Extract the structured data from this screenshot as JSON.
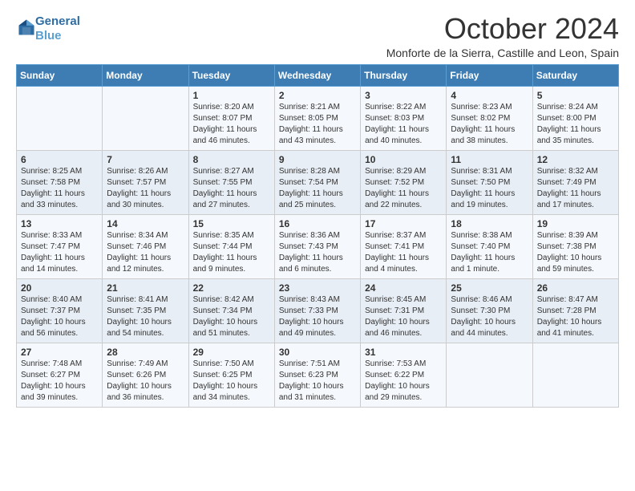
{
  "header": {
    "logo_line1": "General",
    "logo_line2": "Blue",
    "month_title": "October 2024",
    "location": "Monforte de la Sierra, Castille and Leon, Spain"
  },
  "weekdays": [
    "Sunday",
    "Monday",
    "Tuesday",
    "Wednesday",
    "Thursday",
    "Friday",
    "Saturday"
  ],
  "weeks": [
    [
      {
        "day": "",
        "info": ""
      },
      {
        "day": "",
        "info": ""
      },
      {
        "day": "1",
        "info": "Sunrise: 8:20 AM\nSunset: 8:07 PM\nDaylight: 11 hours and 46 minutes."
      },
      {
        "day": "2",
        "info": "Sunrise: 8:21 AM\nSunset: 8:05 PM\nDaylight: 11 hours and 43 minutes."
      },
      {
        "day": "3",
        "info": "Sunrise: 8:22 AM\nSunset: 8:03 PM\nDaylight: 11 hours and 40 minutes."
      },
      {
        "day": "4",
        "info": "Sunrise: 8:23 AM\nSunset: 8:02 PM\nDaylight: 11 hours and 38 minutes."
      },
      {
        "day": "5",
        "info": "Sunrise: 8:24 AM\nSunset: 8:00 PM\nDaylight: 11 hours and 35 minutes."
      }
    ],
    [
      {
        "day": "6",
        "info": "Sunrise: 8:25 AM\nSunset: 7:58 PM\nDaylight: 11 hours and 33 minutes."
      },
      {
        "day": "7",
        "info": "Sunrise: 8:26 AM\nSunset: 7:57 PM\nDaylight: 11 hours and 30 minutes."
      },
      {
        "day": "8",
        "info": "Sunrise: 8:27 AM\nSunset: 7:55 PM\nDaylight: 11 hours and 27 minutes."
      },
      {
        "day": "9",
        "info": "Sunrise: 8:28 AM\nSunset: 7:54 PM\nDaylight: 11 hours and 25 minutes."
      },
      {
        "day": "10",
        "info": "Sunrise: 8:29 AM\nSunset: 7:52 PM\nDaylight: 11 hours and 22 minutes."
      },
      {
        "day": "11",
        "info": "Sunrise: 8:31 AM\nSunset: 7:50 PM\nDaylight: 11 hours and 19 minutes."
      },
      {
        "day": "12",
        "info": "Sunrise: 8:32 AM\nSunset: 7:49 PM\nDaylight: 11 hours and 17 minutes."
      }
    ],
    [
      {
        "day": "13",
        "info": "Sunrise: 8:33 AM\nSunset: 7:47 PM\nDaylight: 11 hours and 14 minutes."
      },
      {
        "day": "14",
        "info": "Sunrise: 8:34 AM\nSunset: 7:46 PM\nDaylight: 11 hours and 12 minutes."
      },
      {
        "day": "15",
        "info": "Sunrise: 8:35 AM\nSunset: 7:44 PM\nDaylight: 11 hours and 9 minutes."
      },
      {
        "day": "16",
        "info": "Sunrise: 8:36 AM\nSunset: 7:43 PM\nDaylight: 11 hours and 6 minutes."
      },
      {
        "day": "17",
        "info": "Sunrise: 8:37 AM\nSunset: 7:41 PM\nDaylight: 11 hours and 4 minutes."
      },
      {
        "day": "18",
        "info": "Sunrise: 8:38 AM\nSunset: 7:40 PM\nDaylight: 11 hours and 1 minute."
      },
      {
        "day": "19",
        "info": "Sunrise: 8:39 AM\nSunset: 7:38 PM\nDaylight: 10 hours and 59 minutes."
      }
    ],
    [
      {
        "day": "20",
        "info": "Sunrise: 8:40 AM\nSunset: 7:37 PM\nDaylight: 10 hours and 56 minutes."
      },
      {
        "day": "21",
        "info": "Sunrise: 8:41 AM\nSunset: 7:35 PM\nDaylight: 10 hours and 54 minutes."
      },
      {
        "day": "22",
        "info": "Sunrise: 8:42 AM\nSunset: 7:34 PM\nDaylight: 10 hours and 51 minutes."
      },
      {
        "day": "23",
        "info": "Sunrise: 8:43 AM\nSunset: 7:33 PM\nDaylight: 10 hours and 49 minutes."
      },
      {
        "day": "24",
        "info": "Sunrise: 8:45 AM\nSunset: 7:31 PM\nDaylight: 10 hours and 46 minutes."
      },
      {
        "day": "25",
        "info": "Sunrise: 8:46 AM\nSunset: 7:30 PM\nDaylight: 10 hours and 44 minutes."
      },
      {
        "day": "26",
        "info": "Sunrise: 8:47 AM\nSunset: 7:28 PM\nDaylight: 10 hours and 41 minutes."
      }
    ],
    [
      {
        "day": "27",
        "info": "Sunrise: 7:48 AM\nSunset: 6:27 PM\nDaylight: 10 hours and 39 minutes."
      },
      {
        "day": "28",
        "info": "Sunrise: 7:49 AM\nSunset: 6:26 PM\nDaylight: 10 hours and 36 minutes."
      },
      {
        "day": "29",
        "info": "Sunrise: 7:50 AM\nSunset: 6:25 PM\nDaylight: 10 hours and 34 minutes."
      },
      {
        "day": "30",
        "info": "Sunrise: 7:51 AM\nSunset: 6:23 PM\nDaylight: 10 hours and 31 minutes."
      },
      {
        "day": "31",
        "info": "Sunrise: 7:53 AM\nSunset: 6:22 PM\nDaylight: 10 hours and 29 minutes."
      },
      {
        "day": "",
        "info": ""
      },
      {
        "day": "",
        "info": ""
      }
    ]
  ]
}
